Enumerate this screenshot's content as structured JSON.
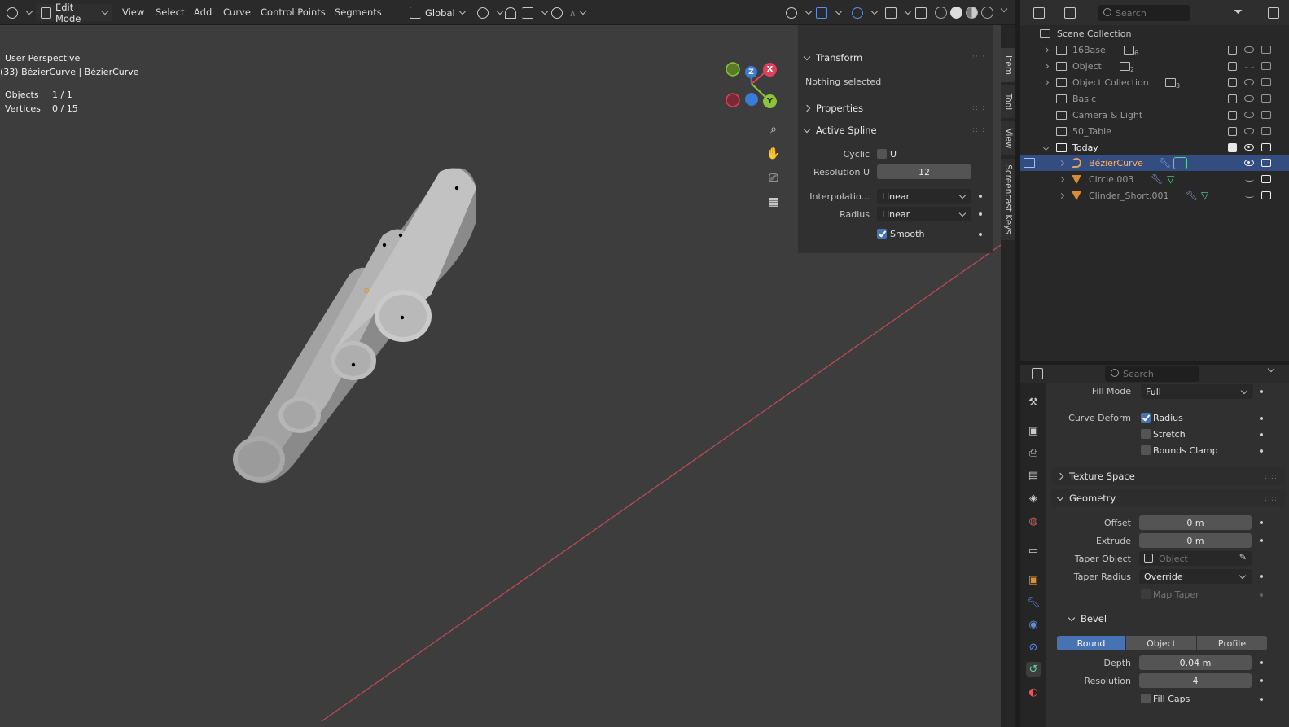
{
  "header": {
    "mode": "Edit Mode",
    "menus": [
      "View",
      "Select",
      "Add",
      "Curve",
      "Control Points",
      "Segments"
    ],
    "orientation": "Global"
  },
  "viewport": {
    "perspective": "User Perspective",
    "object_name": "(33) BézierCurve | BézierCurve",
    "stats": [
      {
        "label": "Objects",
        "value": "1 / 1"
      },
      {
        "label": "Vertices",
        "value": "0 / 15"
      }
    ],
    "gizmo": {
      "x": "X",
      "y": "Y",
      "z": "Z"
    }
  },
  "npanel": {
    "tabs": [
      "Item",
      "Tool",
      "View",
      "Screencast Keys"
    ],
    "transform_title": "Transform",
    "nothing_selected": "Nothing selected",
    "properties_title": "Properties",
    "active_spline_title": "Active Spline",
    "cyclic_label": "Cyclic",
    "cyclic_u": "U",
    "resolution_label": "Resolution U",
    "resolution_value": "12",
    "interpolation_label": "Interpolatio...",
    "interpolation_value": "Linear",
    "radius_label": "Radius",
    "radius_value": "Linear",
    "smooth_label": "Smooth"
  },
  "outliner": {
    "search_placeholder": "Search",
    "rows": [
      {
        "name": "Scene Collection"
      },
      {
        "name": "16Base",
        "count": "6"
      },
      {
        "name": "Object",
        "count": "2"
      },
      {
        "name": "Object Collection",
        "count": "3"
      },
      {
        "name": "Basic"
      },
      {
        "name": "Camera & Light"
      },
      {
        "name": "50_Table"
      },
      {
        "name": "Today"
      },
      {
        "name": "BézierCurve"
      },
      {
        "name": "Circle.003"
      },
      {
        "name": "Clinder_Short.001"
      }
    ]
  },
  "properties": {
    "search_placeholder": "Search",
    "fill_mode_label": "Fill Mode",
    "fill_mode_value": "Full",
    "curve_deform_label": "Curve Deform",
    "radius_label": "Radius",
    "stretch_label": "Stretch",
    "bounds_clamp_label": "Bounds Clamp",
    "texture_space_title": "Texture Space",
    "geometry_title": "Geometry",
    "offset_label": "Offset",
    "offset_value": "0 m",
    "extrude_label": "Extrude",
    "extrude_value": "0 m",
    "taper_object_label": "Taper Object",
    "taper_object_placeholder": "Object",
    "taper_radius_label": "Taper Radius",
    "taper_radius_value": "Override",
    "map_taper_label": "Map Taper",
    "bevel_title": "Bevel",
    "bevel_modes": [
      "Round",
      "Object",
      "Profile"
    ],
    "depth_label": "Depth",
    "depth_value": "0.04 m",
    "resolution_label": "Resolution",
    "resolution_value": "4",
    "fill_caps_label": "Fill Caps"
  },
  "colors": {
    "accent": "#4772b3",
    "x_axis": "#e0405a",
    "y_axis": "#8cc43c",
    "z_axis": "#3b7bd8",
    "selection_row": "#334d80"
  }
}
